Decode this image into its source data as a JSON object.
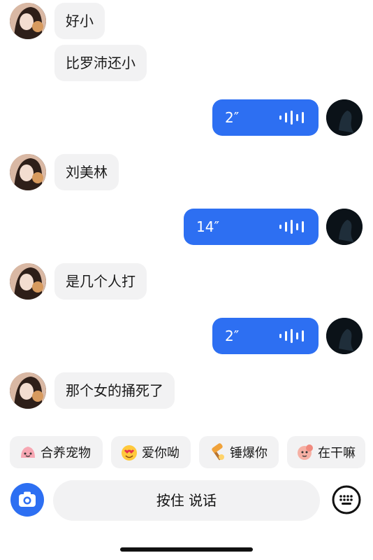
{
  "messages": [
    {
      "side": "in",
      "text": "好小"
    },
    {
      "side": "in",
      "text": "比罗沛还小"
    },
    {
      "side": "out",
      "duration": "2″"
    },
    {
      "side": "in",
      "text": "刘美林"
    },
    {
      "side": "out",
      "duration": "14″"
    },
    {
      "side": "in",
      "text": "是几个人打"
    },
    {
      "side": "out",
      "duration": "2″"
    },
    {
      "side": "in",
      "text": "那个女的捅死了"
    }
  ],
  "quick_replies": [
    {
      "label": "合养宠物",
      "icon": "pet-face-icon"
    },
    {
      "label": "爱你呦",
      "icon": "heart-eyes-icon"
    },
    {
      "label": "锤爆你",
      "icon": "hammer-icon"
    },
    {
      "label": "在干嘛",
      "icon": "peeking-icon"
    }
  ],
  "input_bar": {
    "hold_to_talk_label": "按住 说话",
    "camera_icon": "camera-icon",
    "keyboard_icon": "keyboard-icon"
  },
  "colors": {
    "accent": "#2d6ff2",
    "bubble_in": "#f2f2f3",
    "background": "#ffffff"
  }
}
